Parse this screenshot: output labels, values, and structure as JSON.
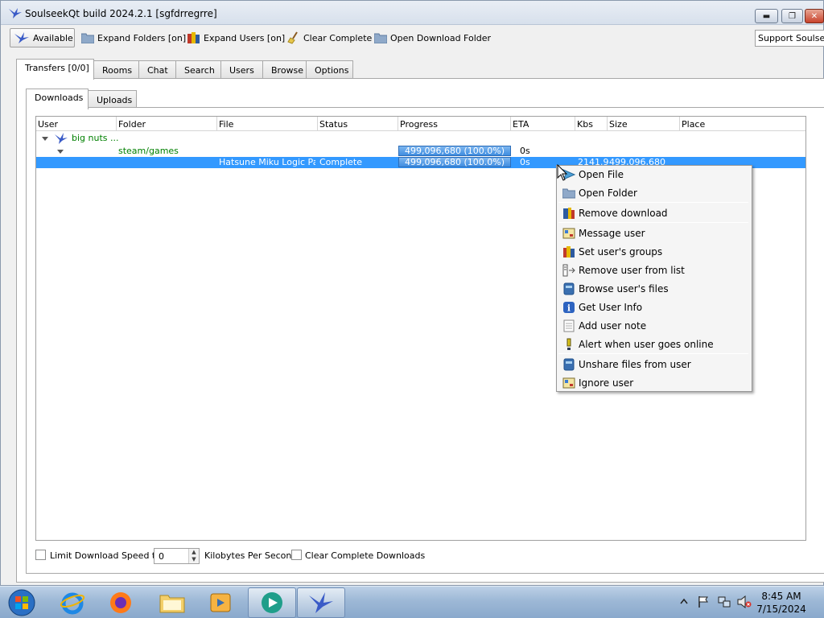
{
  "window": {
    "title": "SoulseekQt build 2024.2.1 [sgfdrregrre]",
    "controls": {
      "minimize": "▬",
      "maximize": "❐",
      "close": "✕"
    }
  },
  "toolbar": {
    "status_label": "Available",
    "expand_folders_label": "Expand Folders [on]",
    "expand_users_label": "Expand Users [on]",
    "clear_complete_label": "Clear Complete",
    "open_download_folder_label": "Open Download Folder",
    "support_label": "Support Soulseek"
  },
  "tabs": [
    "Transfers [0/0]",
    "Rooms",
    "Chat",
    "Search",
    "Users",
    "Browse",
    "Options"
  ],
  "active_tab": "Transfers [0/0]",
  "subtabs": [
    "Downloads",
    "Uploads"
  ],
  "active_subtab": "Downloads",
  "table": {
    "columns": [
      "User",
      "Folder",
      "File",
      "Status",
      "Progress",
      "ETA",
      "Kbs",
      "Size",
      "Place"
    ],
    "user_row": {
      "user": "big nuts ..."
    },
    "folder_row": {
      "folder": "steam/games",
      "progress": "499,096,680 (100.0%)",
      "progress_fraction": 1.0,
      "eta": "0s"
    },
    "file_row": {
      "file": "Hatsune Miku Logic Pai...",
      "status": "Complete",
      "progress": "499,096,680 (100.0%)",
      "progress_fraction": 1.0,
      "eta": "0s",
      "kbs": "2141.9",
      "size": "499,096,680"
    }
  },
  "bottom": {
    "limit_label": "Limit Download Speed to",
    "limit_value": "0",
    "unit_label": "Kilobytes Per Second",
    "clear_label": "Clear Complete Downloads"
  },
  "context_menu": {
    "items": [
      {
        "label": "Open File",
        "icon": "play-arrow-icon"
      },
      {
        "label": "Open Folder",
        "icon": "folder-icon"
      },
      {
        "label": "Remove download",
        "icon": "remove-download-icon"
      },
      {
        "label": "Message user",
        "icon": "message-icon"
      },
      {
        "label": "Set user's groups",
        "icon": "groups-icon"
      },
      {
        "label": "Remove user from list",
        "icon": "remove-user-icon"
      },
      {
        "label": "Browse user's files",
        "icon": "browse-files-icon"
      },
      {
        "label": "Get User Info",
        "icon": "info-icon"
      },
      {
        "label": "Add user note",
        "icon": "note-icon"
      },
      {
        "label": "Alert when user goes online",
        "icon": "alert-icon"
      },
      {
        "label": "Unshare files from user",
        "icon": "unshare-icon"
      },
      {
        "label": "Ignore user",
        "icon": "ignore-icon"
      }
    ]
  },
  "taskbar": {
    "time": "8:45 AM",
    "date": "7/15/2024",
    "apps": [
      "start-orb",
      "internet-explorer",
      "firefox",
      "file-explorer",
      "media-player",
      "media-center",
      "soulseek"
    ]
  },
  "colors": {
    "selection": "#3399ff",
    "tree_text": "#008000",
    "progress": "#3f8de0"
  }
}
